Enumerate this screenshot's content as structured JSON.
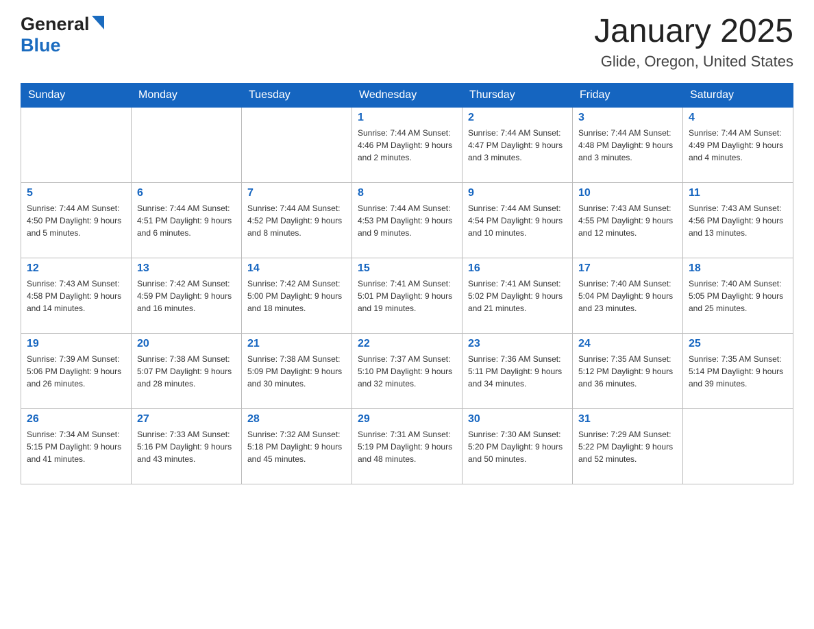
{
  "header": {
    "logo_general": "General",
    "logo_blue": "Blue",
    "month_title": "January 2025",
    "location": "Glide, Oregon, United States"
  },
  "weekdays": [
    "Sunday",
    "Monday",
    "Tuesday",
    "Wednesday",
    "Thursday",
    "Friday",
    "Saturday"
  ],
  "weeks": [
    [
      {
        "day": "",
        "info": ""
      },
      {
        "day": "",
        "info": ""
      },
      {
        "day": "",
        "info": ""
      },
      {
        "day": "1",
        "info": "Sunrise: 7:44 AM\nSunset: 4:46 PM\nDaylight: 9 hours\nand 2 minutes."
      },
      {
        "day": "2",
        "info": "Sunrise: 7:44 AM\nSunset: 4:47 PM\nDaylight: 9 hours\nand 3 minutes."
      },
      {
        "day": "3",
        "info": "Sunrise: 7:44 AM\nSunset: 4:48 PM\nDaylight: 9 hours\nand 3 minutes."
      },
      {
        "day": "4",
        "info": "Sunrise: 7:44 AM\nSunset: 4:49 PM\nDaylight: 9 hours\nand 4 minutes."
      }
    ],
    [
      {
        "day": "5",
        "info": "Sunrise: 7:44 AM\nSunset: 4:50 PM\nDaylight: 9 hours\nand 5 minutes."
      },
      {
        "day": "6",
        "info": "Sunrise: 7:44 AM\nSunset: 4:51 PM\nDaylight: 9 hours\nand 6 minutes."
      },
      {
        "day": "7",
        "info": "Sunrise: 7:44 AM\nSunset: 4:52 PM\nDaylight: 9 hours\nand 8 minutes."
      },
      {
        "day": "8",
        "info": "Sunrise: 7:44 AM\nSunset: 4:53 PM\nDaylight: 9 hours\nand 9 minutes."
      },
      {
        "day": "9",
        "info": "Sunrise: 7:44 AM\nSunset: 4:54 PM\nDaylight: 9 hours\nand 10 minutes."
      },
      {
        "day": "10",
        "info": "Sunrise: 7:43 AM\nSunset: 4:55 PM\nDaylight: 9 hours\nand 12 minutes."
      },
      {
        "day": "11",
        "info": "Sunrise: 7:43 AM\nSunset: 4:56 PM\nDaylight: 9 hours\nand 13 minutes."
      }
    ],
    [
      {
        "day": "12",
        "info": "Sunrise: 7:43 AM\nSunset: 4:58 PM\nDaylight: 9 hours\nand 14 minutes."
      },
      {
        "day": "13",
        "info": "Sunrise: 7:42 AM\nSunset: 4:59 PM\nDaylight: 9 hours\nand 16 minutes."
      },
      {
        "day": "14",
        "info": "Sunrise: 7:42 AM\nSunset: 5:00 PM\nDaylight: 9 hours\nand 18 minutes."
      },
      {
        "day": "15",
        "info": "Sunrise: 7:41 AM\nSunset: 5:01 PM\nDaylight: 9 hours\nand 19 minutes."
      },
      {
        "day": "16",
        "info": "Sunrise: 7:41 AM\nSunset: 5:02 PM\nDaylight: 9 hours\nand 21 minutes."
      },
      {
        "day": "17",
        "info": "Sunrise: 7:40 AM\nSunset: 5:04 PM\nDaylight: 9 hours\nand 23 minutes."
      },
      {
        "day": "18",
        "info": "Sunrise: 7:40 AM\nSunset: 5:05 PM\nDaylight: 9 hours\nand 25 minutes."
      }
    ],
    [
      {
        "day": "19",
        "info": "Sunrise: 7:39 AM\nSunset: 5:06 PM\nDaylight: 9 hours\nand 26 minutes."
      },
      {
        "day": "20",
        "info": "Sunrise: 7:38 AM\nSunset: 5:07 PM\nDaylight: 9 hours\nand 28 minutes."
      },
      {
        "day": "21",
        "info": "Sunrise: 7:38 AM\nSunset: 5:09 PM\nDaylight: 9 hours\nand 30 minutes."
      },
      {
        "day": "22",
        "info": "Sunrise: 7:37 AM\nSunset: 5:10 PM\nDaylight: 9 hours\nand 32 minutes."
      },
      {
        "day": "23",
        "info": "Sunrise: 7:36 AM\nSunset: 5:11 PM\nDaylight: 9 hours\nand 34 minutes."
      },
      {
        "day": "24",
        "info": "Sunrise: 7:35 AM\nSunset: 5:12 PM\nDaylight: 9 hours\nand 36 minutes."
      },
      {
        "day": "25",
        "info": "Sunrise: 7:35 AM\nSunset: 5:14 PM\nDaylight: 9 hours\nand 39 minutes."
      }
    ],
    [
      {
        "day": "26",
        "info": "Sunrise: 7:34 AM\nSunset: 5:15 PM\nDaylight: 9 hours\nand 41 minutes."
      },
      {
        "day": "27",
        "info": "Sunrise: 7:33 AM\nSunset: 5:16 PM\nDaylight: 9 hours\nand 43 minutes."
      },
      {
        "day": "28",
        "info": "Sunrise: 7:32 AM\nSunset: 5:18 PM\nDaylight: 9 hours\nand 45 minutes."
      },
      {
        "day": "29",
        "info": "Sunrise: 7:31 AM\nSunset: 5:19 PM\nDaylight: 9 hours\nand 48 minutes."
      },
      {
        "day": "30",
        "info": "Sunrise: 7:30 AM\nSunset: 5:20 PM\nDaylight: 9 hours\nand 50 minutes."
      },
      {
        "day": "31",
        "info": "Sunrise: 7:29 AM\nSunset: 5:22 PM\nDaylight: 9 hours\nand 52 minutes."
      },
      {
        "day": "",
        "info": ""
      }
    ]
  ]
}
